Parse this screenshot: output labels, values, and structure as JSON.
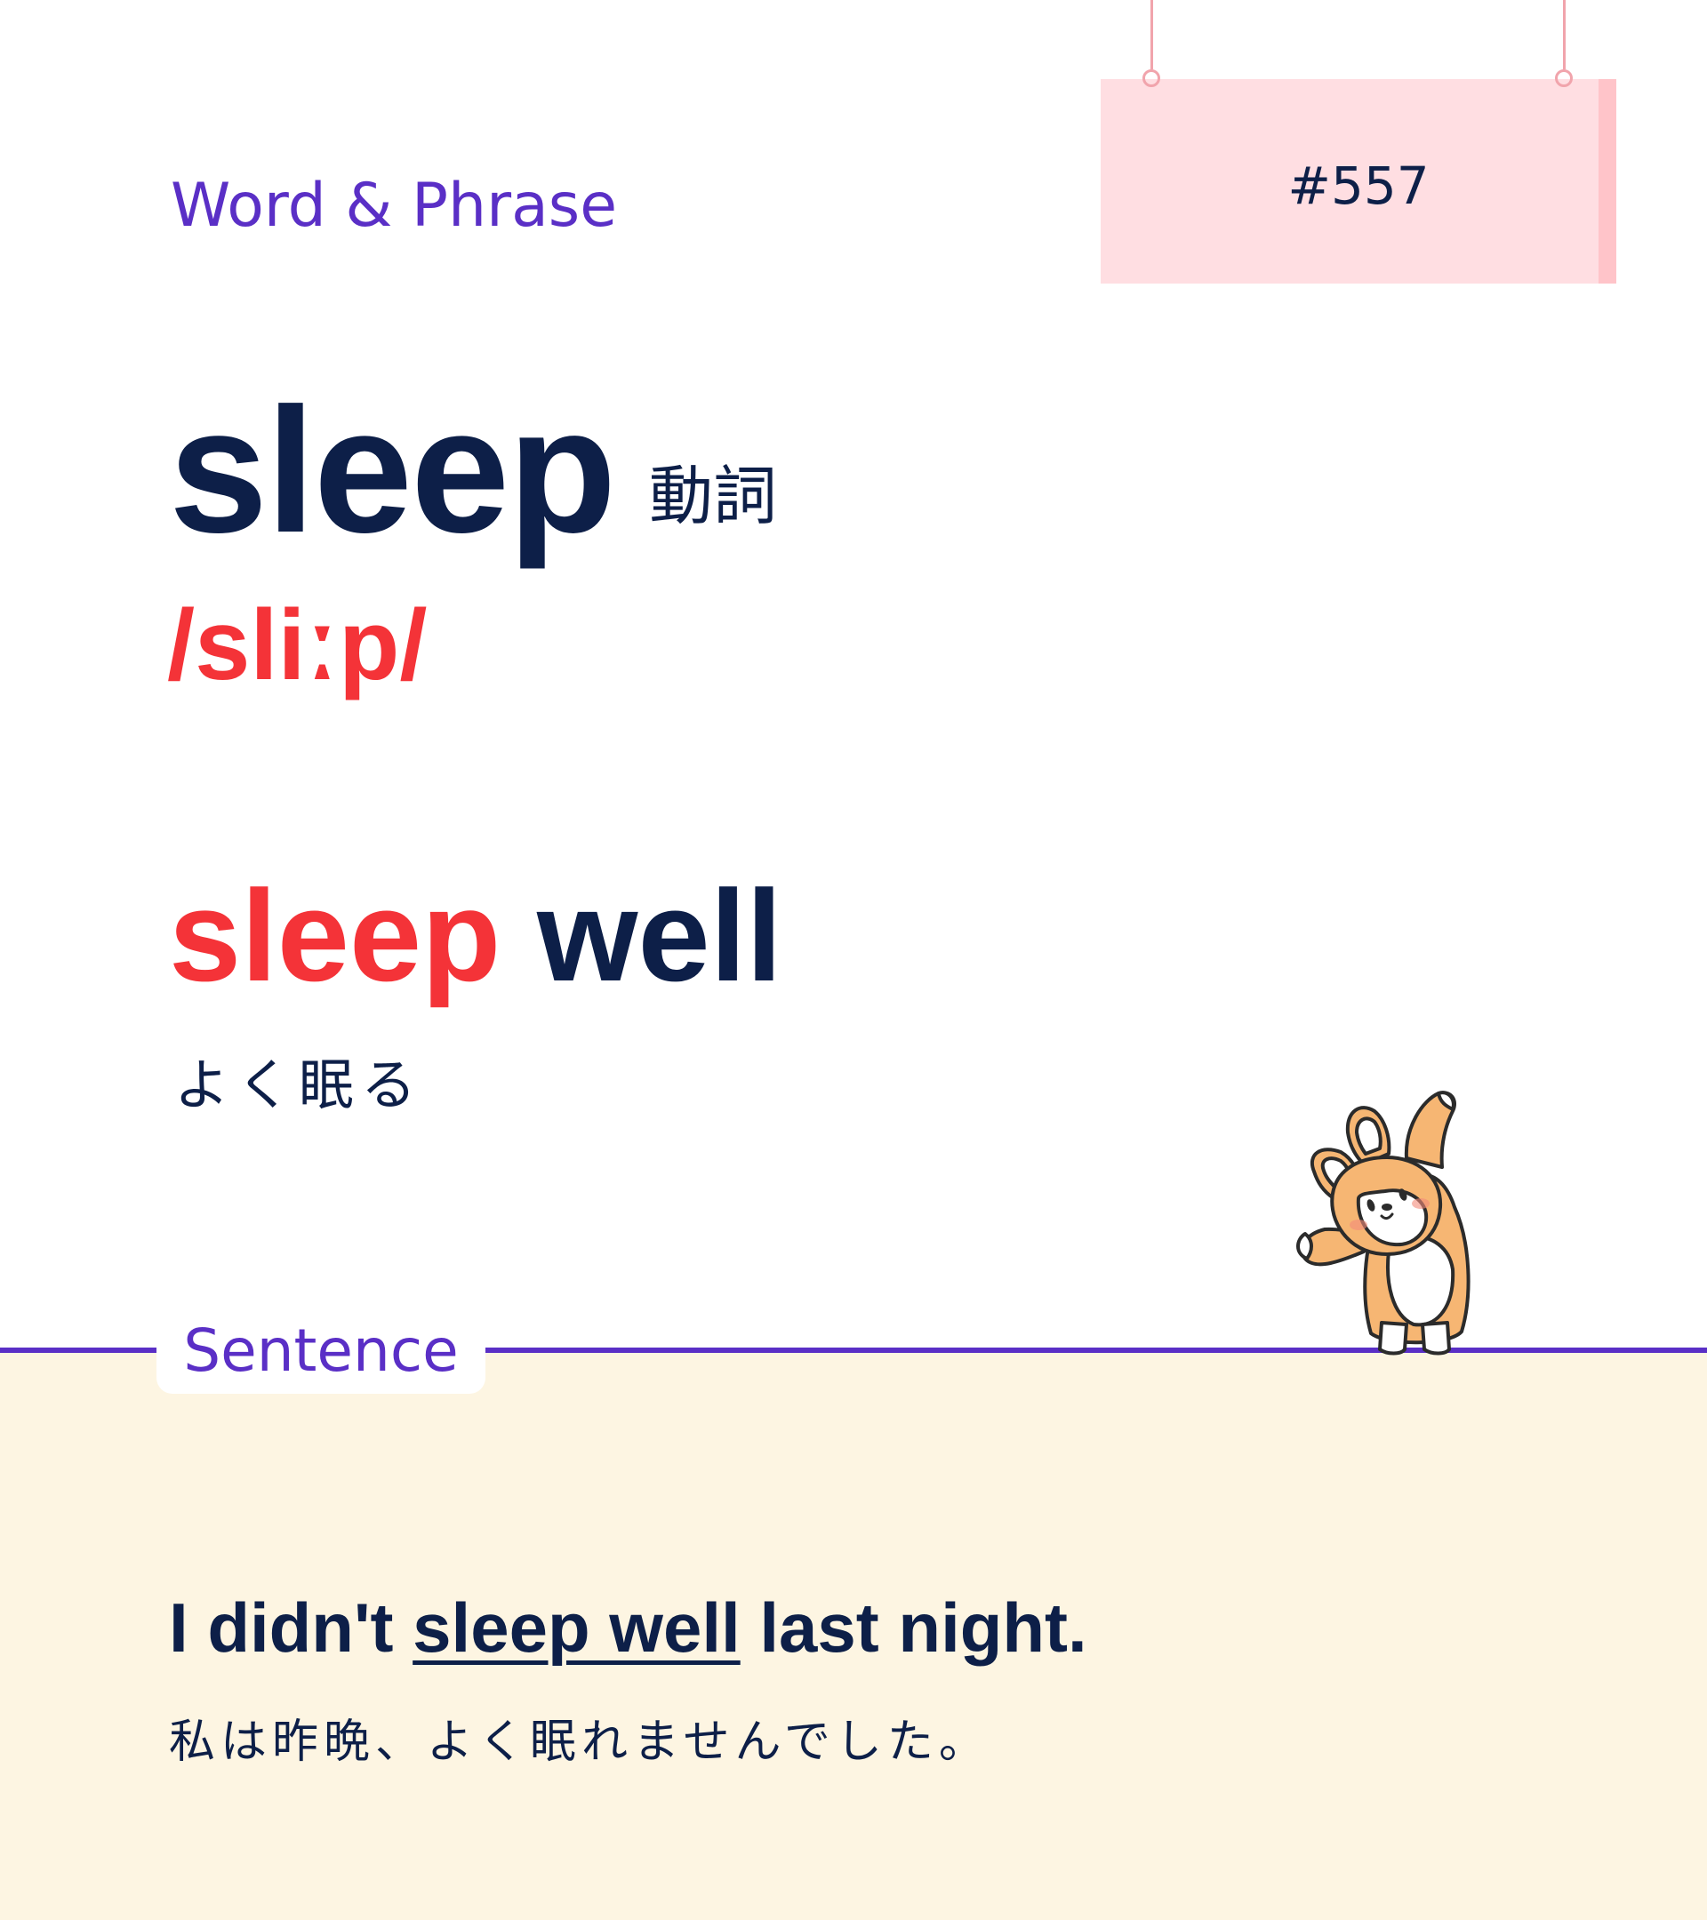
{
  "header": {
    "section_label": "Word & Phrase",
    "entry_number": "#557"
  },
  "word": {
    "headword": "sleep",
    "part_of_speech": "動詞",
    "pronunciation": "/sliːp/"
  },
  "phrase": {
    "highlight": "sleep",
    "rest": " well",
    "translation": "よく眠る"
  },
  "sentence": {
    "tab_label": "Sentence",
    "english_before": "I didn't ",
    "english_underlined": "sleep well",
    "english_after": " last night.",
    "translation": "私は昨晩、よく眠れませんでした。"
  },
  "decorations": {
    "sign_icon": "hanging-sign-icon",
    "mascot_icon": "corgi-dog-icon"
  },
  "colors": {
    "navy": "#0d1f48",
    "accent_red": "#f43338",
    "purple": "#5a2fc6",
    "sign_pink": "#ffdee2",
    "cream": "#fdf5e2"
  }
}
